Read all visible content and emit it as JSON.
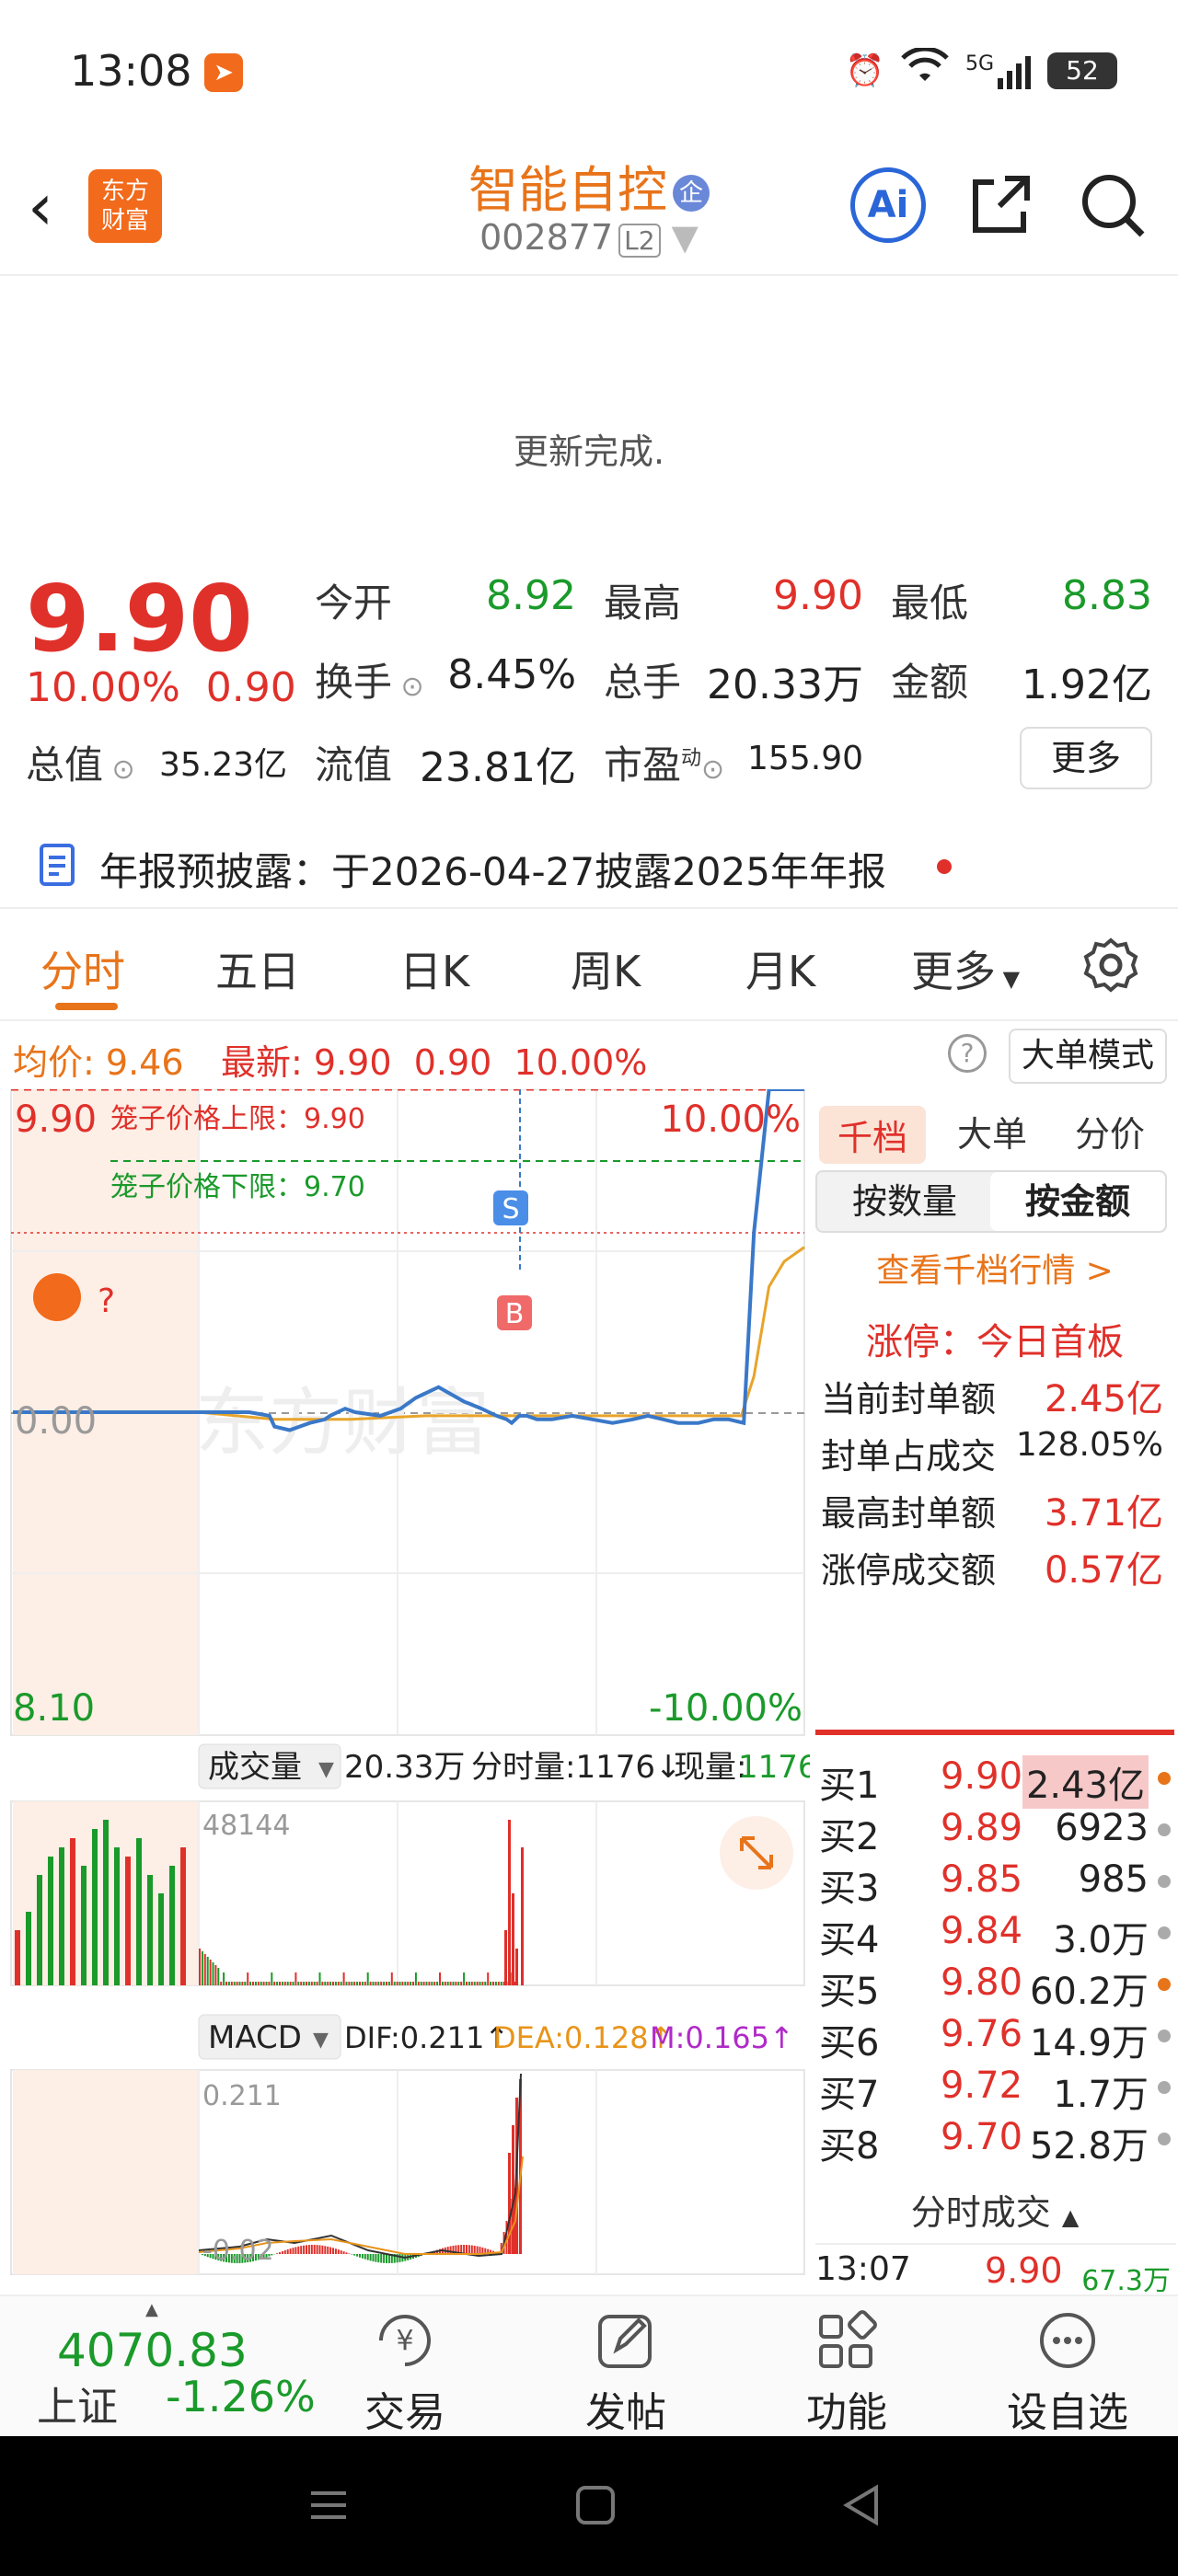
{
  "status_bar": {
    "time": "13:08",
    "network": "5G",
    "battery": "52"
  },
  "nav": {
    "logo_line1": "东方",
    "logo_line2": "财富",
    "title": "智能自控",
    "ent_badge": "企",
    "code": "002877",
    "level": "L2",
    "ai_label": "Ai"
  },
  "refresh_text": "更新完成.",
  "quote": {
    "price": "9.90",
    "change_pct": "10.00%",
    "change": "0.90",
    "open_label": "今开",
    "open": "8.92",
    "high_label": "最高",
    "high": "9.90",
    "low_label": "最低",
    "low": "8.83",
    "turnover_label": "换手",
    "turnover": "8.45%",
    "volume_label": "总手",
    "volume": "20.33万",
    "amount_label": "金额",
    "amount": "1.92亿",
    "total_value_label": "总值",
    "total_value": "35.23亿",
    "float_label": "流值",
    "float_value": "23.81亿",
    "pe_label": "市盈",
    "pe_sup": "动",
    "pe": "155.90",
    "more_label": "更多"
  },
  "notice": "年报预披露：于2026-04-27披露2025年年报",
  "tabs": [
    "分时",
    "五日",
    "日K",
    "周K",
    "月K",
    "更多"
  ],
  "info_line": {
    "avg_label": "均价:",
    "avg": "9.46",
    "latest_label": "最新:",
    "latest": "9.90",
    "chg": "0.90",
    "pct": "10.00%",
    "mode_button": "大单模式"
  },
  "chart": {
    "top_price": "9.90",
    "top_pct": "10.00%",
    "bottom_price": "8.10",
    "bottom_pct": "-10.00%",
    "zero": "0.00",
    "cage_upper": "笼子价格上限：9.90",
    "cage_lower": "笼子价格下限：9.70",
    "watermark": "东方财富",
    "marker_s": "S",
    "marker_b": "B",
    "mascot_q": "?",
    "vol_label": "成交量",
    "vol_total": "20.33万",
    "vol_period": "分时量:1176↓",
    "vol_now_label": "现量:",
    "vol_now": "1176",
    "vol_max": "48144",
    "macd_label": "MACD",
    "dif": "DIF:0.211↑",
    "dea": "DEA:0.128↑",
    "m": "M:0.165↑",
    "macd_max": "0.211",
    "macd_min": "-0.02"
  },
  "chart_data": {
    "type": "line",
    "series": [
      {
        "name": "price",
        "x": [
          0,
          10,
          20,
          28,
          30,
          36,
          44,
          50,
          52,
          58,
          62,
          72,
          80,
          86,
          95,
          105,
          112,
          118,
          122,
          124,
          127,
          130,
          134,
          140,
          148,
          156,
          164,
          172,
          178,
          184,
          190,
          198,
          204,
          210,
          216,
          220,
          226,
          232,
          238,
          240
        ],
        "y": [
          9.0,
          9.0,
          9.0,
          8.99,
          8.96,
          8.95,
          8.97,
          8.98,
          8.99,
          9.01,
          9.0,
          8.99,
          9.01,
          9.04,
          9.07,
          9.03,
          9.01,
          8.99,
          8.98,
          8.97,
          8.99,
          8.99,
          8.98,
          8.98,
          8.99,
          8.98,
          8.97,
          8.98,
          8.99,
          8.98,
          8.97,
          8.97,
          8.98,
          8.98,
          8.97,
          9.5,
          9.9,
          9.9,
          9.9,
          9.9
        ]
      },
      {
        "name": "avg",
        "x": [
          0,
          30,
          60,
          90,
          120,
          150,
          180,
          215,
          220,
          226,
          232,
          240
        ],
        "y": [
          9.0,
          8.98,
          8.98,
          8.99,
          8.99,
          8.99,
          8.99,
          8.99,
          9.1,
          9.35,
          9.42,
          9.46
        ]
      }
    ],
    "ylim": [
      8.1,
      9.9
    ]
  },
  "right_panel": {
    "tabs": [
      "千档",
      "大单",
      "分价"
    ],
    "seg": [
      "按数量",
      "按金额"
    ],
    "link": "查看千档行情 >",
    "limit_title": "涨停：今日首板",
    "stats": [
      {
        "label": "当前封单额",
        "value": "2.45亿",
        "color": "red"
      },
      {
        "label": "封单占成交",
        "value": "128.05%",
        "color": "dark"
      },
      {
        "label": "最高封单额",
        "value": "3.71亿",
        "color": "red"
      },
      {
        "label": "涨停成交额",
        "value": "0.57亿",
        "color": "red"
      }
    ],
    "bids": [
      {
        "label": "买1",
        "price": "9.90",
        "vol": "2.43亿",
        "dot": "#e8741a"
      },
      {
        "label": "买2",
        "price": "9.89",
        "vol": "6923",
        "dot": "#aaa"
      },
      {
        "label": "买3",
        "price": "9.85",
        "vol": "985",
        "dot": "#aaa"
      },
      {
        "label": "买4",
        "price": "9.84",
        "vol": "3.0万",
        "dot": "#aaa"
      },
      {
        "label": "买5",
        "price": "9.80",
        "vol": "60.2万",
        "dot": "#e8741a"
      },
      {
        "label": "买6",
        "price": "9.76",
        "vol": "14.9万",
        "dot": "#aaa"
      },
      {
        "label": "买7",
        "price": "9.72",
        "vol": "1.7万",
        "dot": "#aaa"
      },
      {
        "label": "买8",
        "price": "9.70",
        "vol": "52.8万",
        "dot": "#aaa"
      }
    ],
    "trades_title": "分时成交",
    "trade": {
      "time": "13:07",
      "price": "9.90",
      "vol": "67.3万"
    }
  },
  "bottom_bar": {
    "index_value": "4070.83",
    "index_name": "上证",
    "index_pct": "-1.26%",
    "items": [
      "交易",
      "发帖",
      "功能",
      "设自选"
    ]
  }
}
